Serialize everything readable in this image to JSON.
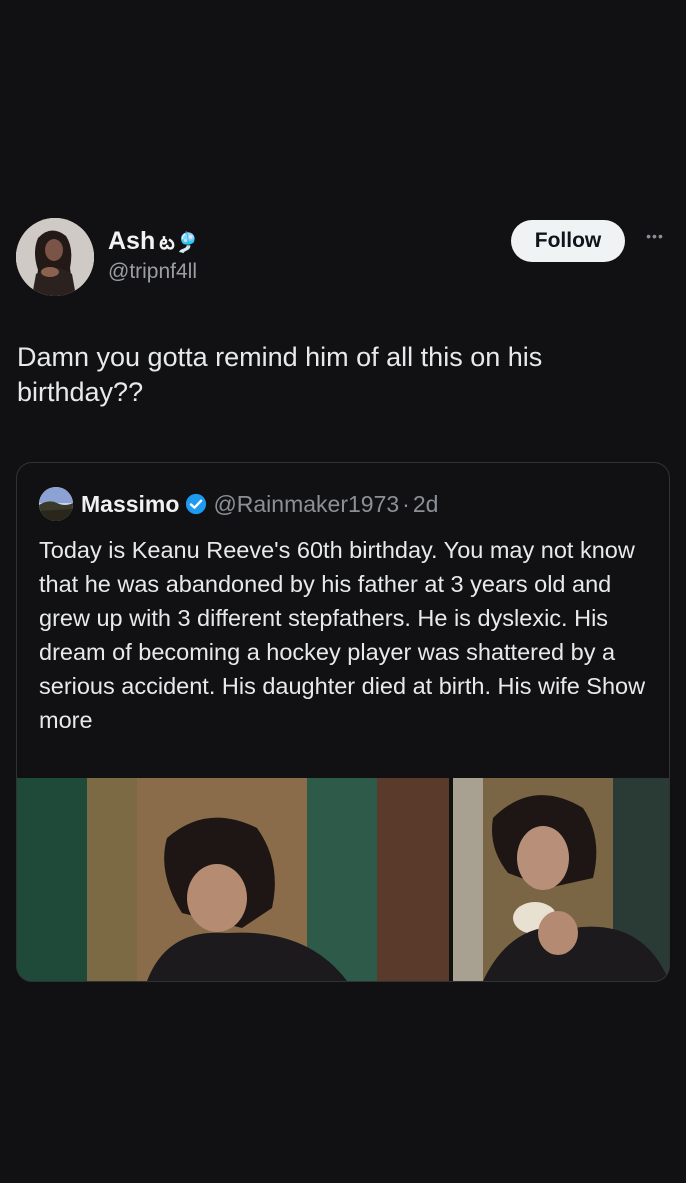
{
  "post": {
    "author": {
      "display_name": "Ash",
      "name_emoji": "ట🎐",
      "handle": "@tripnf4ll",
      "avatar_icon": "avatar-photo-icon"
    },
    "follow_label": "Follow",
    "more_label": "•••",
    "text": "Damn you gotta remind him of all this on his birthday??"
  },
  "quote": {
    "author": {
      "display_name": "Massimo",
      "verified_icon": "verified-badge-icon",
      "handle": "@Rainmaker1973",
      "separator": "·",
      "time": "2d"
    },
    "text": "Today is Keanu Reeve's 60th birthday. You may not know that he was abandoned by his father at 3 years old and grew up with 3 different stepfathers. He is dyslexic. His dream of becoming a hockey player was shattered by a serious accident. His daughter died at birth. His wife",
    "show_more": "Show more",
    "media": [
      {
        "icon": "photo-man-sitting-icon"
      },
      {
        "icon": "photo-man-eating-icon"
      }
    ]
  },
  "colors": {
    "background": "#111113",
    "text": "#e7e9ea",
    "secondary_text": "#8b9096",
    "follow_button": "#eff3f4",
    "verified": "#1d9bf0",
    "card_border": "#2f3336"
  }
}
